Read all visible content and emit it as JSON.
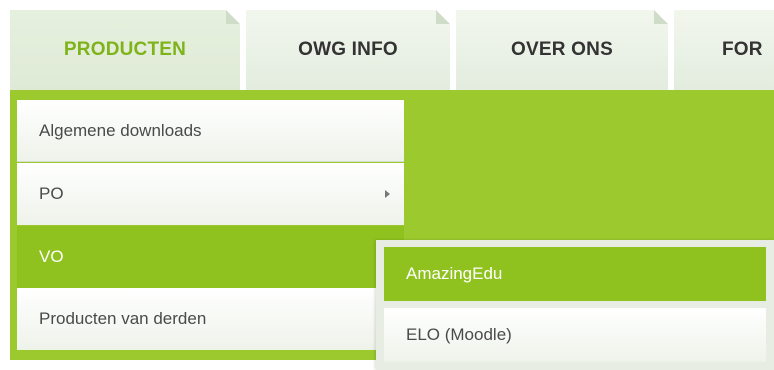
{
  "nav": {
    "tabs": [
      {
        "label": "PRODUCTEN",
        "active": true
      },
      {
        "label": "OWG INFO",
        "active": false
      },
      {
        "label": "OVER ONS",
        "active": false
      },
      {
        "label": "FOR",
        "active": false
      }
    ]
  },
  "dropdown": {
    "items": [
      {
        "label": "Algemene downloads",
        "has_submenu": false
      },
      {
        "label": "PO",
        "has_submenu": true
      },
      {
        "label": "VO",
        "has_submenu": true,
        "active": true
      },
      {
        "label": "Producten van derden",
        "has_submenu": false
      }
    ]
  },
  "submenu": {
    "items": [
      {
        "label": "AmazingEdu",
        "active": true
      },
      {
        "label": "ELO (Moodle)",
        "active": false
      }
    ]
  },
  "colors": {
    "accent_green": "#9cc92e",
    "active_item_green": "#8fc21f",
    "active_tab_text": "#7fb31a"
  }
}
